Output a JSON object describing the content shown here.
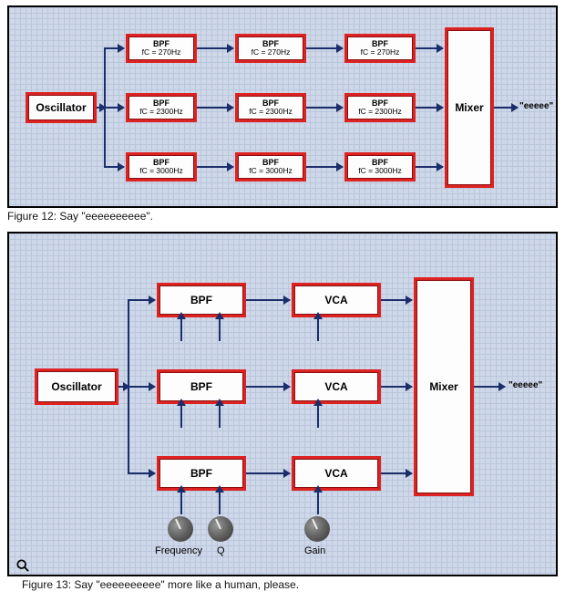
{
  "figure12": {
    "caption": "Figure 12: Say \"eeeeeeeeee\".",
    "oscillator": "Oscillator",
    "mixer": "Mixer",
    "output": "\"eeeee\"",
    "rows": [
      {
        "label": "BPF",
        "sub": "fC = 270Hz"
      },
      {
        "label": "BPF",
        "sub": "fC = 2300Hz"
      },
      {
        "label": "BPF",
        "sub": "fC = 3000Hz"
      }
    ]
  },
  "figure13": {
    "caption": "Figure 13: Say \"eeeeeeeeee\" more like a human, please.",
    "oscillator": "Oscillator",
    "mixer": "Mixer",
    "output": "\"eeeee\"",
    "bpf": "BPF",
    "vca": "VCA",
    "knobs": {
      "frequency": "Frequency",
      "q": "Q",
      "gain": "Gain"
    }
  },
  "chart_data": [
    {
      "type": "diagram",
      "title": "Figure 12",
      "nodes": [
        {
          "id": "osc",
          "label": "Oscillator"
        },
        {
          "id": "bpf_r1_c1",
          "label": "BPF",
          "param": "fC=270Hz"
        },
        {
          "id": "bpf_r1_c2",
          "label": "BPF",
          "param": "fC=270Hz"
        },
        {
          "id": "bpf_r1_c3",
          "label": "BPF",
          "param": "fC=270Hz"
        },
        {
          "id": "bpf_r2_c1",
          "label": "BPF",
          "param": "fC=2300Hz"
        },
        {
          "id": "bpf_r2_c2",
          "label": "BPF",
          "param": "fC=2300Hz"
        },
        {
          "id": "bpf_r2_c3",
          "label": "BPF",
          "param": "fC=2300Hz"
        },
        {
          "id": "bpf_r3_c1",
          "label": "BPF",
          "param": "fC=3000Hz"
        },
        {
          "id": "bpf_r3_c2",
          "label": "BPF",
          "param": "fC=3000Hz"
        },
        {
          "id": "bpf_r3_c3",
          "label": "BPF",
          "param": "fC=3000Hz"
        },
        {
          "id": "mixer",
          "label": "Mixer"
        },
        {
          "id": "out",
          "label": "\"eeeee\""
        }
      ],
      "edges": [
        [
          "osc",
          "bpf_r1_c1"
        ],
        [
          "osc",
          "bpf_r2_c1"
        ],
        [
          "osc",
          "bpf_r3_c1"
        ],
        [
          "bpf_r1_c1",
          "bpf_r1_c2"
        ],
        [
          "bpf_r1_c2",
          "bpf_r1_c3"
        ],
        [
          "bpf_r1_c3",
          "mixer"
        ],
        [
          "bpf_r2_c1",
          "bpf_r2_c2"
        ],
        [
          "bpf_r2_c2",
          "bpf_r2_c3"
        ],
        [
          "bpf_r2_c3",
          "mixer"
        ],
        [
          "bpf_r3_c1",
          "bpf_r3_c2"
        ],
        [
          "bpf_r3_c2",
          "bpf_r3_c3"
        ],
        [
          "bpf_r3_c3",
          "mixer"
        ],
        [
          "mixer",
          "out"
        ]
      ]
    },
    {
      "type": "diagram",
      "title": "Figure 13",
      "nodes": [
        {
          "id": "osc",
          "label": "Oscillator"
        },
        {
          "id": "bpf_r1",
          "label": "BPF",
          "controls": [
            "Frequency",
            "Q"
          ]
        },
        {
          "id": "vca_r1",
          "label": "VCA",
          "controls": [
            "Gain"
          ]
        },
        {
          "id": "bpf_r2",
          "label": "BPF",
          "controls": [
            "Frequency",
            "Q"
          ]
        },
        {
          "id": "vca_r2",
          "label": "VCA",
          "controls": [
            "Gain"
          ]
        },
        {
          "id": "bpf_r3",
          "label": "BPF",
          "controls": [
            "Frequency",
            "Q"
          ]
        },
        {
          "id": "vca_r3",
          "label": "VCA",
          "controls": [
            "Gain"
          ]
        },
        {
          "id": "mixer",
          "label": "Mixer"
        },
        {
          "id": "out",
          "label": "\"eeeee\""
        }
      ],
      "edges": [
        [
          "osc",
          "bpf_r1"
        ],
        [
          "osc",
          "bpf_r2"
        ],
        [
          "osc",
          "bpf_r3"
        ],
        [
          "bpf_r1",
          "vca_r1"
        ],
        [
          "vca_r1",
          "mixer"
        ],
        [
          "bpf_r2",
          "vca_r2"
        ],
        [
          "vca_r2",
          "mixer"
        ],
        [
          "bpf_r3",
          "vca_r3"
        ],
        [
          "vca_r3",
          "mixer"
        ],
        [
          "mixer",
          "out"
        ]
      ],
      "knobs": [
        "Frequency",
        "Q",
        "Gain"
      ]
    }
  ]
}
